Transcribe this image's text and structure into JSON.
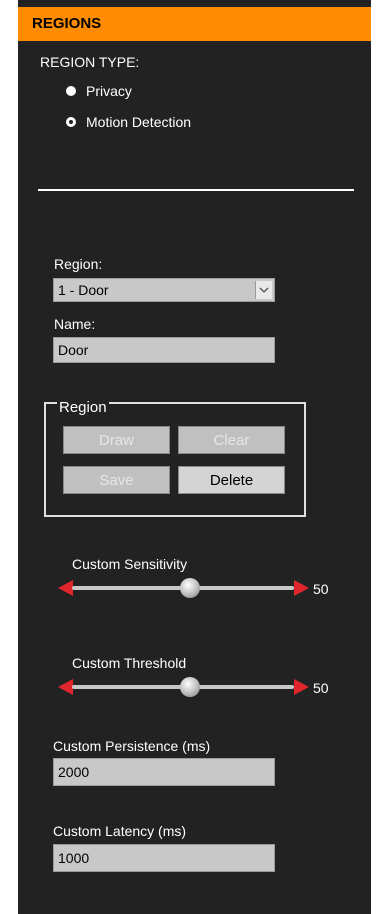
{
  "panel": {
    "title": "REGIONS"
  },
  "region_type": {
    "label": "REGION TYPE:",
    "options": [
      {
        "label": "Privacy",
        "selected": false
      },
      {
        "label": "Motion Detection",
        "selected": true
      }
    ]
  },
  "region_select": {
    "label": "Region:",
    "value": "1 - Door"
  },
  "name_field": {
    "label": "Name:",
    "value": "Door"
  },
  "region_group": {
    "legend": "Region",
    "buttons": {
      "draw": "Draw",
      "clear": "Clear",
      "save": "Save",
      "delete": "Delete"
    }
  },
  "sensitivity": {
    "label": "Custom Sensitivity",
    "value": "50"
  },
  "threshold": {
    "label": "Custom Threshold",
    "value": "50"
  },
  "persistence": {
    "label": "Custom Persistence (ms)",
    "value": "2000"
  },
  "latency": {
    "label": "Custom Latency (ms)",
    "value": "1000"
  },
  "colors": {
    "header": "#ff8c00",
    "panel": "#222222",
    "arrow": "#e0262d"
  }
}
